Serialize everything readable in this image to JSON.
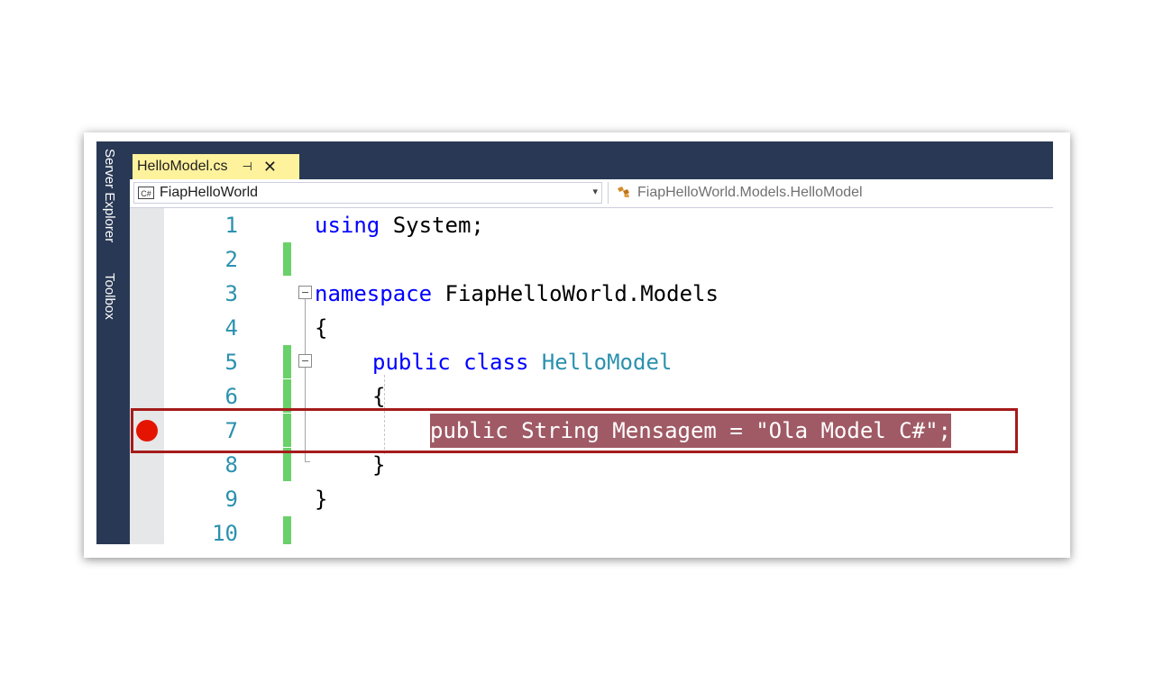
{
  "sidebar": {
    "tabs": [
      "Server Explorer",
      "Toolbox"
    ]
  },
  "tab": {
    "filename": "HelloModel.cs",
    "pin_glyph": "⊣",
    "close_glyph": "✕"
  },
  "navbar": {
    "project_icon": "C#",
    "project": "FiapHelloWorld",
    "dropdown_glyph": "▾",
    "class_icon": "class-icon",
    "class_path": "FiapHelloWorld.Models.HelloModel"
  },
  "code": {
    "lines": [
      {
        "num": "1",
        "text": "using System;"
      },
      {
        "num": "2",
        "text": ""
      },
      {
        "num": "3",
        "text": "namespace FiapHelloWorld.Models"
      },
      {
        "num": "4",
        "text": "{"
      },
      {
        "num": "5",
        "text": "public class HelloModel"
      },
      {
        "num": "6",
        "text": "{"
      },
      {
        "num": "7",
        "text": "public String Mensagem = \"Ola Model C#\";"
      },
      {
        "num": "8",
        "text": "}"
      },
      {
        "num": "9",
        "text": "}"
      },
      {
        "num": "10",
        "text": ""
      }
    ],
    "breakpoint_line": 7
  },
  "colors": {
    "window_bg": "#293955",
    "tab_active": "#fff29d",
    "keyword": "#0000ff",
    "type": "#2b91af",
    "line_number": "#2b91af",
    "modified_bar": "#6ad06a",
    "breakpoint": "#e51400",
    "highlight": "#a05a65",
    "callout_border": "#a51b1b"
  }
}
